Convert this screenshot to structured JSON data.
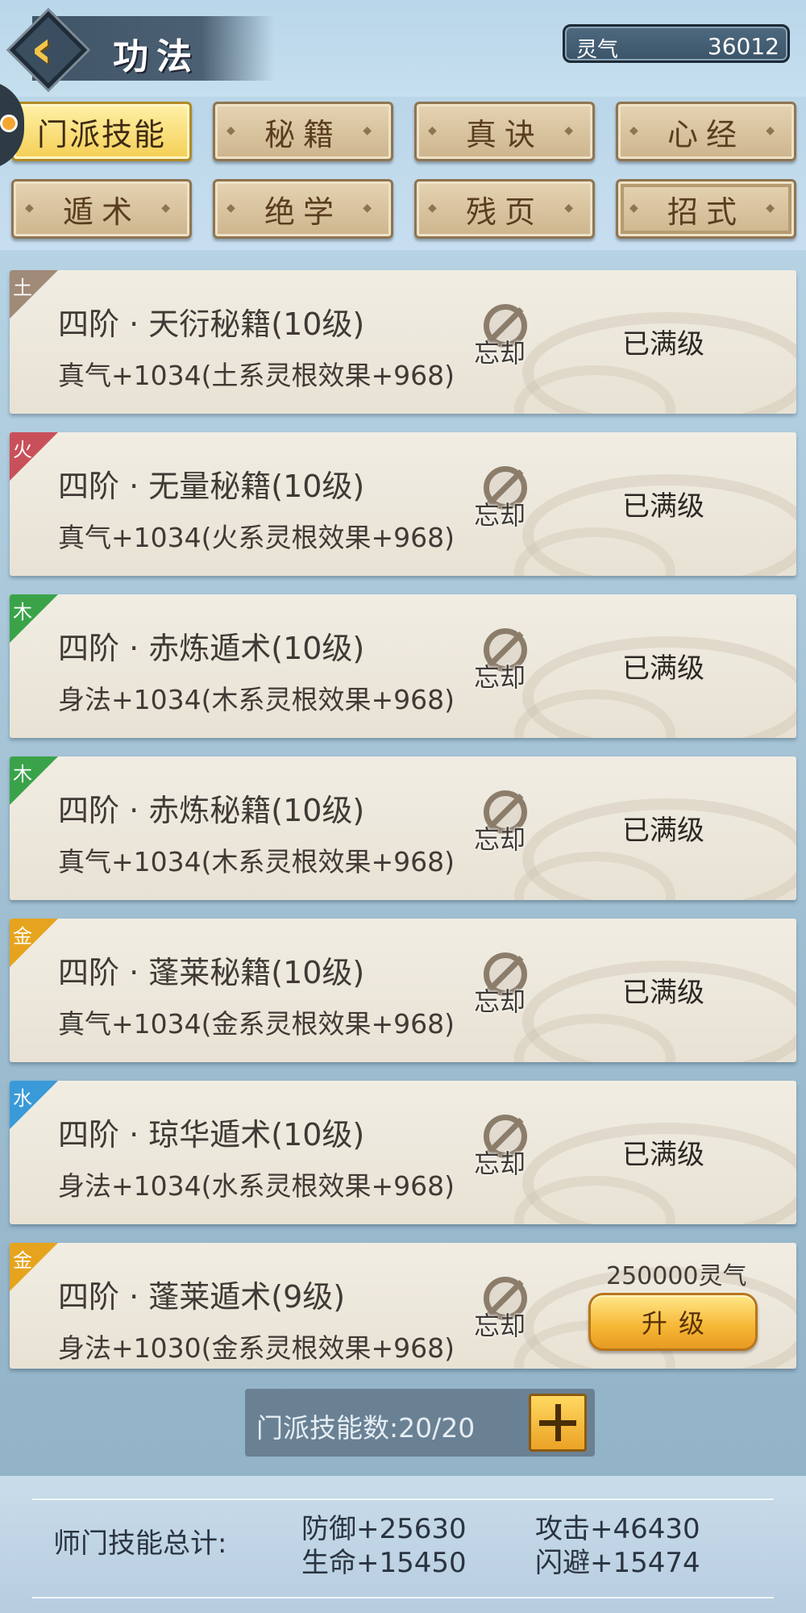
{
  "header": {
    "title": "功法",
    "currency_label": "灵气",
    "currency_value": "36012"
  },
  "tabs": [
    {
      "label": "门派技能",
      "active": true
    },
    {
      "label": "秘籍",
      "active": false
    },
    {
      "label": "真诀",
      "active": false
    },
    {
      "label": "心经",
      "active": false
    },
    {
      "label": "遁术",
      "active": false
    },
    {
      "label": "绝学",
      "active": false
    },
    {
      "label": "残页",
      "active": false
    },
    {
      "label": "招式",
      "active": false
    }
  ],
  "skills": [
    {
      "element": "土",
      "element_color": "#a08a78",
      "name": "四阶 · 天衍秘籍(10级)",
      "desc": "真气+1034(土系灵根效果+968)",
      "forget_label": "忘却",
      "status": "已满级"
    },
    {
      "element": "火",
      "element_color": "#c9505a",
      "name": "四阶 · 无量秘籍(10级)",
      "desc": "真气+1034(火系灵根效果+968)",
      "forget_label": "忘却",
      "status": "已满级"
    },
    {
      "element": "木",
      "element_color": "#3aa34a",
      "name": "四阶 · 赤炼遁术(10级)",
      "desc": "身法+1034(木系灵根效果+968)",
      "forget_label": "忘却",
      "status": "已满级"
    },
    {
      "element": "木",
      "element_color": "#3aa34a",
      "name": "四阶 · 赤炼秘籍(10级)",
      "desc": "真气+1034(木系灵根效果+968)",
      "forget_label": "忘却",
      "status": "已满级"
    },
    {
      "element": "金",
      "element_color": "#e6a41e",
      "name": "四阶 · 蓬莱秘籍(10级)",
      "desc": "真气+1034(金系灵根效果+968)",
      "forget_label": "忘却",
      "status": "已满级"
    },
    {
      "element": "水",
      "element_color": "#3a9ad8",
      "name": "四阶 · 琼华遁术(10级)",
      "desc": "身法+1034(水系灵根效果+968)",
      "forget_label": "忘却",
      "status": "已满级"
    },
    {
      "element": "金",
      "element_color": "#e6a41e",
      "name": "四阶 · 蓬莱遁术(9级)",
      "desc": "身法+1030(金系灵根效果+968)",
      "forget_label": "忘却",
      "cost": "250000灵气",
      "upgrade_label": "升级"
    }
  ],
  "skill_count": {
    "text": "门派技能数:20/20"
  },
  "totals": {
    "label": "师门技能总计:",
    "defense": "防御+25630",
    "attack": "攻击+46430",
    "life": "生命+15450",
    "dodge": "闪避+15474"
  }
}
